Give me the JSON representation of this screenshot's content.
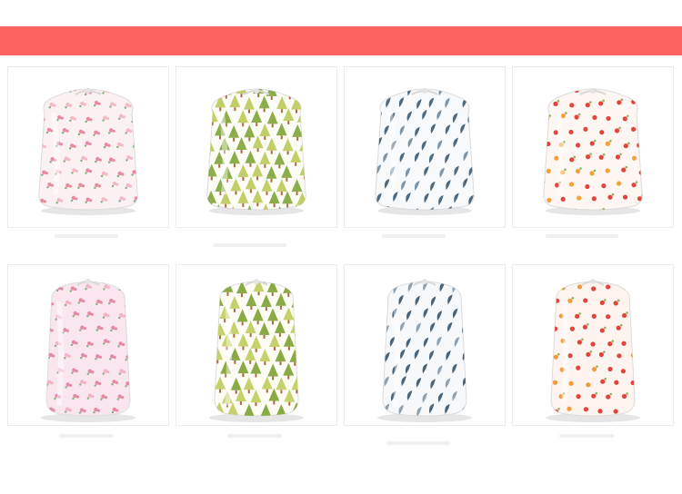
{
  "banner": {
    "color": "#fc6361"
  },
  "products": [
    {
      "name": "pink-floral-bag",
      "shape": "round",
      "pattern": "floral",
      "bg": "#fbf0f2",
      "colors": [
        "#e88aa0",
        "#7fae7a",
        "#f5b9c6"
      ]
    },
    {
      "name": "green-tree-bag",
      "shape": "round",
      "pattern": "trees",
      "bg": "#fdfdf8",
      "colors": [
        "#8cae4a",
        "#c2cf68",
        "#b06a3c"
      ]
    },
    {
      "name": "blue-leaf-bag",
      "shape": "round",
      "pattern": "leaves",
      "bg": "#f8f9fb",
      "colors": [
        "#4f6a7e",
        "#7d95a8"
      ]
    },
    {
      "name": "red-berry-bag",
      "shape": "round",
      "pattern": "berries",
      "bg": "#fdf6f2",
      "colors": [
        "#e2443c",
        "#f3a23b",
        "#8bb35b"
      ]
    },
    {
      "name": "pink-floral-tall",
      "shape": "tall",
      "pattern": "floral",
      "bg": "#f9e6ee",
      "colors": [
        "#e58aa6",
        "#86b07e",
        "#f2b3c6"
      ]
    },
    {
      "name": "green-tree-tall",
      "shape": "tall",
      "pattern": "trees",
      "bg": "#fdfdf6",
      "colors": [
        "#8aaa45",
        "#c5d26c",
        "#b06a3c"
      ]
    },
    {
      "name": "blue-leaf-tall",
      "shape": "tall",
      "pattern": "leaves",
      "bg": "#f7f8fa",
      "colors": [
        "#4a6479",
        "#8ea2b3"
      ]
    },
    {
      "name": "red-berry-tall",
      "shape": "tall",
      "pattern": "berries",
      "bg": "#fdf4f0",
      "colors": [
        "#e0443c",
        "#f29b3a",
        "#8bb35b"
      ]
    }
  ]
}
